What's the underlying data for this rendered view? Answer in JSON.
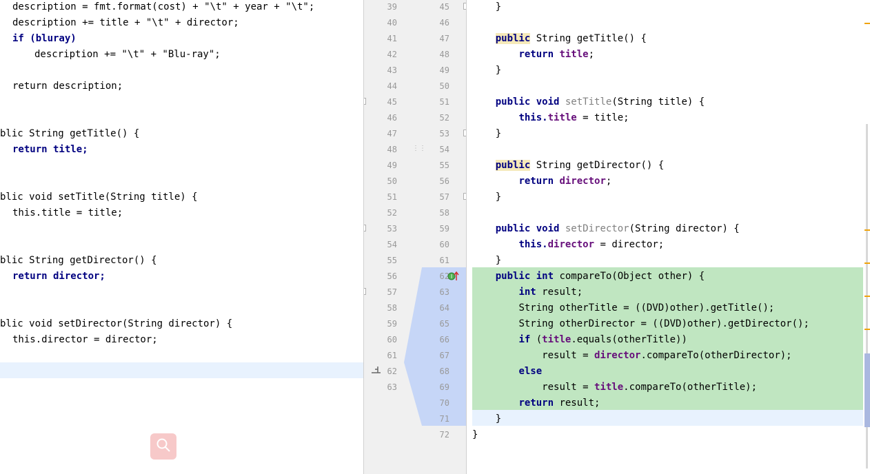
{
  "left_lines": [
    {
      "text": "description = fmt.format(cost) + \"\\t\" + year + \"\\t\";"
    },
    {
      "text": "description += title + \"\\t\" + director;"
    },
    {
      "text": "if (bluray)"
    },
    {
      "text": "description += \"\\t\" + \"Blu-ray\";"
    },
    {
      "text": "return description;"
    },
    {
      "text": "blic String getTitle() {"
    },
    {
      "text": "return title;"
    },
    {
      "text": "blic void setTitle(String title) {"
    },
    {
      "text": "this.title = title;"
    },
    {
      "text": "blic String getDirector() {"
    },
    {
      "text": "return director;"
    },
    {
      "text": "blic void setDirector(String director) {"
    },
    {
      "text": "this.director = director;"
    }
  ],
  "gutter_left": [
    "39",
    "40",
    "41",
    "42",
    "43",
    "44",
    "45",
    "46",
    "47",
    "48",
    "49",
    "50",
    "51",
    "52",
    "53",
    "54",
    "55",
    "56",
    "57",
    "58",
    "59",
    "60",
    "61",
    "62",
    "63"
  ],
  "gutter_right": [
    "45",
    "46",
    "47",
    "48",
    "49",
    "50",
    "51",
    "52",
    "53",
    "54",
    "55",
    "56",
    "57",
    "58",
    "59",
    "60",
    "61",
    "62",
    "63",
    "64",
    "65",
    "66",
    "67",
    "68",
    "69",
    "70",
    "71",
    "72"
  ],
  "right_code": {
    "l0": "    }",
    "l2a": "public",
    "l2b": " String getTitle() {",
    "l3a": "return",
    "l3b": "title",
    "l3c": ";",
    "l4": "    }",
    "l6a": "public void",
    "l6b": "setTitle",
    "l6c": "(String title) {",
    "l7a": "this.",
    "l7b": "title",
    "l7c": " = title;",
    "l8": "    }",
    "l10a": "public",
    "l10b": " String getDirector() {",
    "l11a": "return",
    "l11b": "director",
    "l11c": ";",
    "l12": "    }",
    "l14a": "public void",
    "l14b": "setDirector",
    "l14c": "(String director) {",
    "l15a": "this.",
    "l15b": "director",
    "l15c": " = director;",
    "l16": "    }",
    "l17a": "public int",
    "l17b": " compareTo(Object other) {",
    "l18a": "int",
    "l18b": " result;",
    "l19": "String otherTitle = ((DVD)other).getTitle();",
    "l20": "String otherDirector = ((DVD)other).getDirector();",
    "l21a": "if",
    "l21b": " (",
    "l21c": "title",
    "l21d": ".equals(otherTitle))",
    "l22a": "result = ",
    "l22b": "director",
    "l22c": ".compareTo(otherDirector);",
    "l23": "else",
    "l24a": "result = ",
    "l24b": "title",
    "l24c": ".compareTo(otherTitle);",
    "l25a": "return",
    "l25b": " result;",
    "l26": "}",
    "l27": "}"
  },
  "colors": {
    "added_background": "#c0e6c1",
    "changed_background": "#c6d6f7",
    "keyword": "#000080",
    "field": "#660e7a",
    "string": "#008000"
  },
  "icons": [
    "search-icon",
    "override-icon",
    "fold-icon",
    "drag-handle-icon"
  ]
}
